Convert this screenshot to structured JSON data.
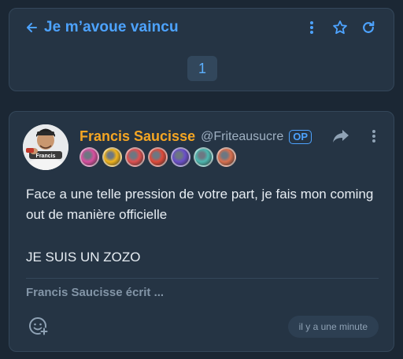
{
  "header": {
    "title": "Je m’avoue vaincu",
    "page_number": "1",
    "icons": [
      "arrow-left-icon",
      "more-vertical-icon",
      "star-icon",
      "refresh-icon"
    ]
  },
  "post": {
    "author_name": "Francis Saucisse",
    "author_handle": "@Friteausucre",
    "op_badge": "OP",
    "avatar_caption": "Francis",
    "body_lines": [
      "Face a une telle pression de votre part, je fais mon coming out de manière officielle",
      "JE SUIS UN ZOZO"
    ],
    "typing_indicator": "Francis Saucisse écrit ...",
    "timestamp": "il y a une minute",
    "badge_colors": [
      "#d94fa0",
      "#f2b51c",
      "#e05050",
      "#e04a3a",
      "#6a4fc9",
      "#4db8b0",
      "#d9704f"
    ]
  },
  "colors": {
    "accent": "#4da3ff",
    "author": "#f5a623",
    "background": "#1b2734",
    "card": "#253444"
  }
}
